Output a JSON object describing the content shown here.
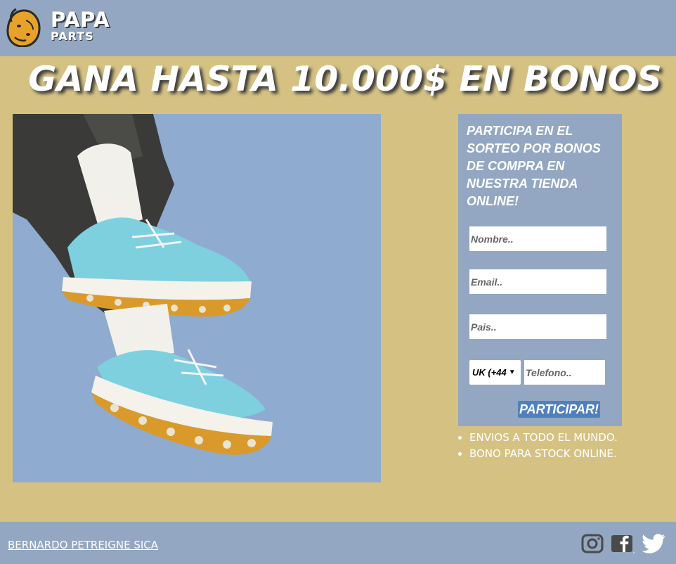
{
  "header": {
    "logo_icon": "potato-icon",
    "brand_line1": "PAPA",
    "brand_line2": "PARTS"
  },
  "headline": "GANA HASTA 10.000$ EN BONOS",
  "hero_image": "photo-of-light-blue-sneakers",
  "form": {
    "title": "PARTICIPA EN EL SORTEO POR BONOS DE COMPRA EN NUESTRA TIENDA ONLINE!",
    "name_placeholder": "Nombre..",
    "email_placeholder": "Email..",
    "country_placeholder": "Pais..",
    "country_code_selected": "UK (+44",
    "phone_placeholder": "Telefono..",
    "submit_label": "PARTICIPAR!"
  },
  "features": [
    "ENVIOS A TODO EL MUNDO.",
    "BONO PARA STOCK ONLINE."
  ],
  "footer": {
    "author": "BERNARDO PETREIGNE SICA",
    "social_icons": [
      "instagram-icon",
      "facebook-icon",
      "twitter-icon"
    ]
  },
  "colors": {
    "header_bg": "#93a7c2",
    "page_bg": "#d5c283",
    "button_bg": "#4f80be",
    "text": "#ffffff"
  }
}
